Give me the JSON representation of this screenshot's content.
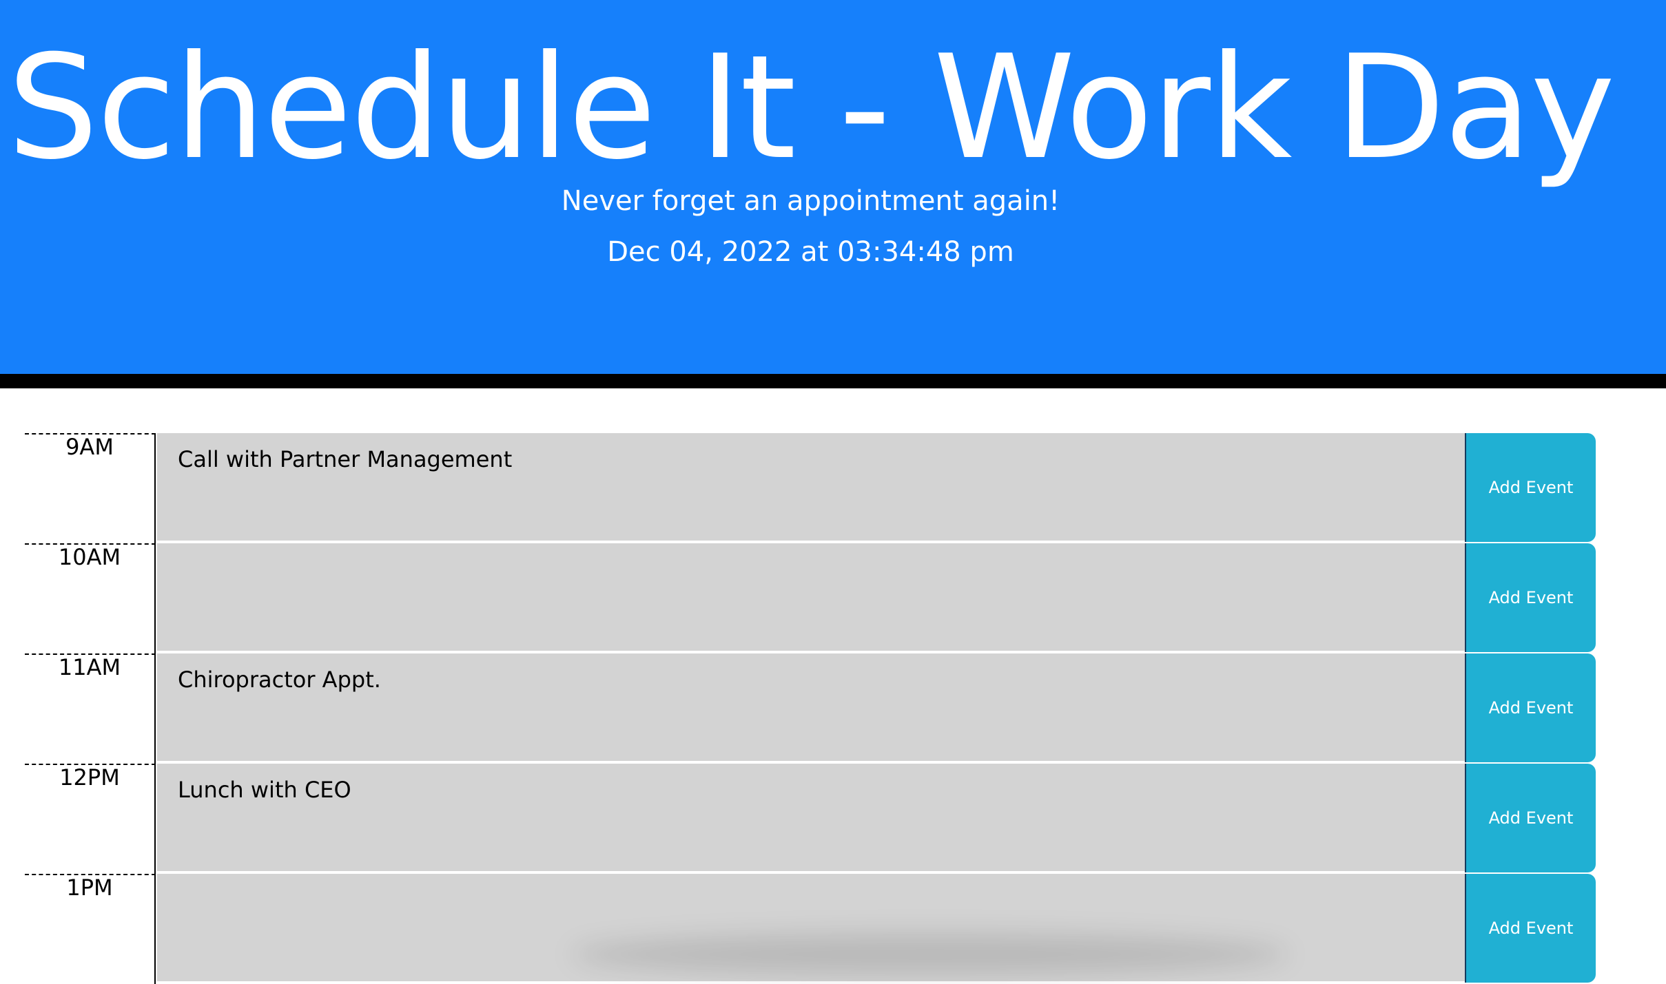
{
  "header": {
    "title": "Schedule It - Work Day",
    "subtitle": "Never forget an appointment again!",
    "datetime": "Dec 04, 2022 at 03:34:48 pm"
  },
  "schedule": {
    "rows": [
      {
        "hour": "9AM",
        "event": "Call with Partner Management",
        "button": "Add Event"
      },
      {
        "hour": "10AM",
        "event": "",
        "button": "Add Event"
      },
      {
        "hour": "11AM",
        "event": "Chiropractor Appt.",
        "button": "Add Event"
      },
      {
        "hour": "12PM",
        "event": "Lunch with CEO",
        "button": "Add Event"
      },
      {
        "hour": "1PM",
        "event": "",
        "button": "Add Event"
      }
    ]
  },
  "colors": {
    "header_bg": "#1680fb",
    "row_bg": "#d3d3d3",
    "button_bg": "#20b0d3"
  }
}
